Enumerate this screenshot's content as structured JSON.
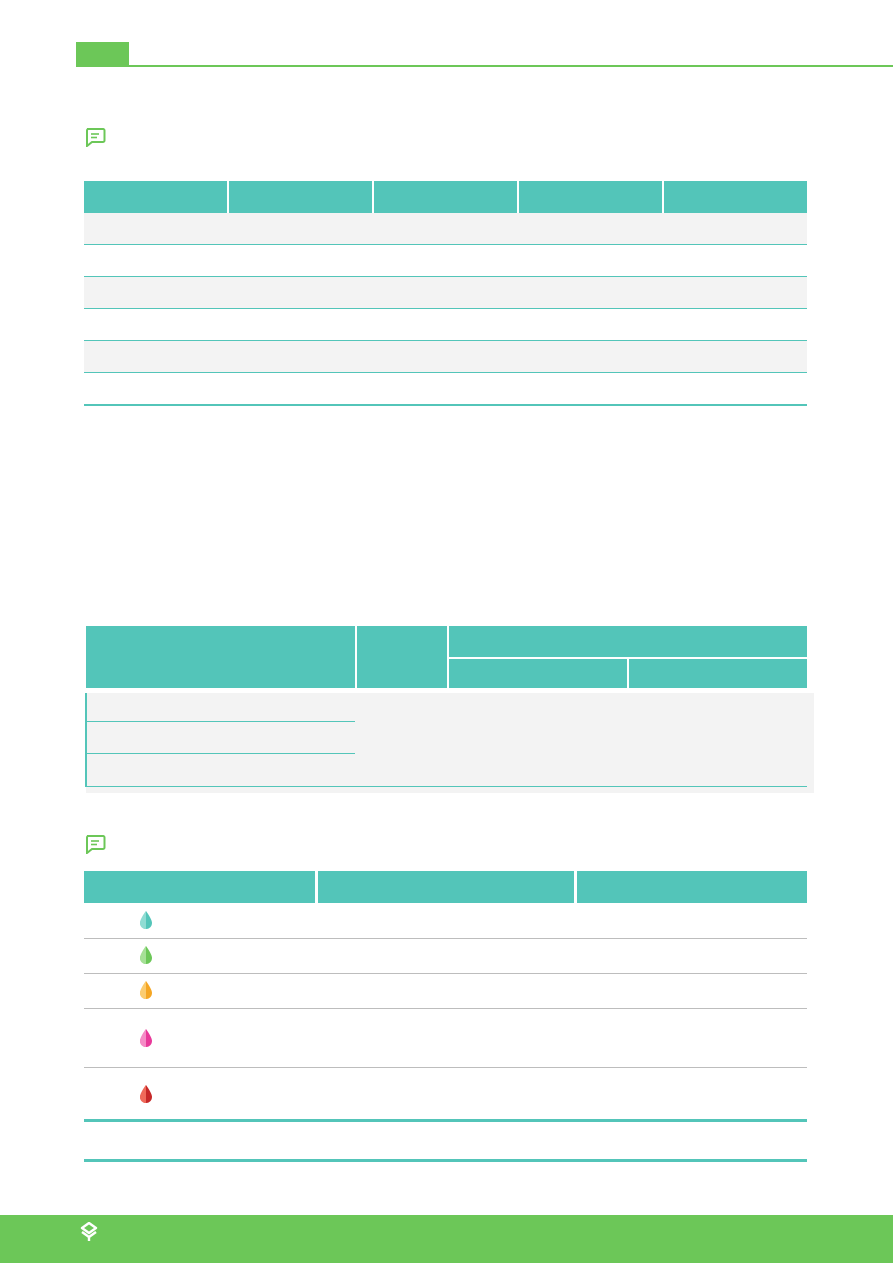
{
  "header": {
    "accent_color": "#6cc758"
  },
  "section1": {
    "icon": "comment-note-icon",
    "table": {
      "header_color": "#53c5b9",
      "columns": [
        "",
        "",
        "",
        "",
        ""
      ],
      "rows": [
        [
          "",
          "",
          "",
          "",
          ""
        ],
        [
          "",
          "",
          "",
          "",
          ""
        ],
        [
          "",
          "",
          "",
          "",
          ""
        ],
        [
          "",
          "",
          "",
          "",
          ""
        ],
        [
          "",
          "",
          "",
          "",
          ""
        ],
        [
          "",
          "",
          "",
          "",
          ""
        ]
      ]
    }
  },
  "section2": {
    "table": {
      "header_color": "#53c5b9",
      "rows": [
        "",
        "",
        ""
      ]
    }
  },
  "section3": {
    "icon": "comment-note-icon",
    "table": {
      "header_color": "#53c5b9",
      "columns": [
        "",
        "",
        ""
      ],
      "rows": [
        {
          "icon": "teal-drop-icon",
          "color": "#53c5b9"
        },
        {
          "icon": "green-drop-icon",
          "color": "#6cc758"
        },
        {
          "icon": "orange-drop-icon",
          "color": "#f5a623"
        },
        {
          "icon": "pink-drop-icon",
          "color": "#e8399a"
        },
        {
          "icon": "red-drop-icon",
          "color": "#d63031"
        }
      ]
    }
  },
  "footer": {
    "color": "#6cc758",
    "logo": "brand-logo-icon"
  }
}
